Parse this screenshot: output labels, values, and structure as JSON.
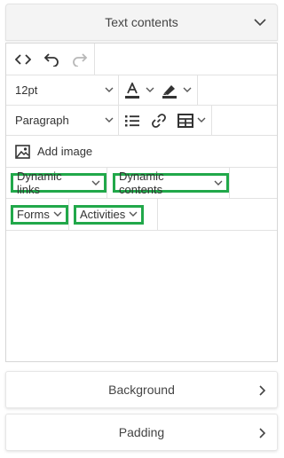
{
  "header": {
    "title": "Text contents"
  },
  "toolbar": {
    "font_size": "12pt",
    "block_format": "Paragraph",
    "add_image_label": "Add image",
    "dynamic_links_label": "Dynamic links",
    "dynamic_contents_label": "Dynamic contents",
    "forms_label": "Forms",
    "activities_label": "Activities"
  },
  "sections": {
    "background": "Background",
    "padding": "Padding"
  },
  "colors": {
    "highlight_border": "#21a84a",
    "icon": "#333333",
    "disabled_icon": "#b8b8b8"
  }
}
